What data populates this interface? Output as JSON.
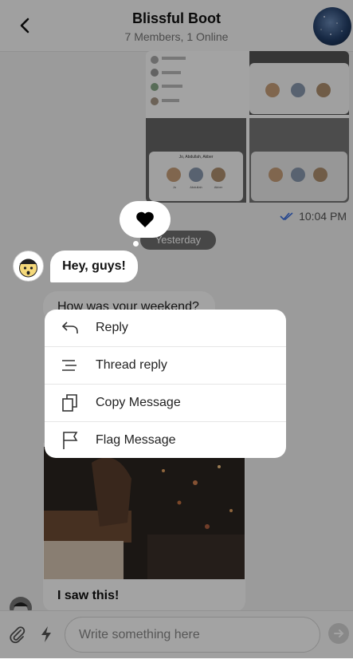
{
  "header": {
    "title": "Blissful Boot",
    "subtitle": "7 Members, 1 Online",
    "back_icon": "chevron-left-icon"
  },
  "messages": {
    "read_time": "10:04 PM",
    "day_chip": "Yesterday",
    "greeting": "Hey, guys!",
    "question": "How was your weekend?",
    "photo_caption": "I saw this!",
    "embedded_screenshot_label": "Jo, Abdullah, Akber",
    "embedded_screenshot_names": [
      "Jo",
      "Abdullah",
      "Akber"
    ]
  },
  "reaction": {
    "icon": "heart-icon"
  },
  "context_menu": {
    "items": [
      {
        "label": "Reply",
        "icon": "reply-icon"
      },
      {
        "label": "Thread reply",
        "icon": "thread-icon"
      },
      {
        "label": "Copy Message",
        "icon": "copy-icon"
      },
      {
        "label": "Flag Message",
        "icon": "flag-icon"
      }
    ]
  },
  "composer": {
    "placeholder": "Write something here",
    "attach_icon": "paperclip-icon",
    "bolt_icon": "lightning-icon",
    "send_icon": "send-icon"
  },
  "colors": {
    "overlay": "#000000",
    "read_check": "#3b6fe0",
    "chip": "#6f6f6f"
  }
}
